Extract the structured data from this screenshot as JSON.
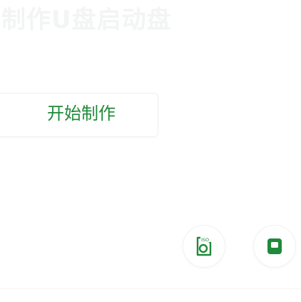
{
  "page": {
    "title": "制作U盘启动盘"
  },
  "actions": {
    "start_label": "开始制作"
  },
  "icons": {
    "iso": "iso-disc-icon",
    "iso_text": "ISO",
    "usb": "usb-drive-icon"
  },
  "colors": {
    "accent": "#1f8a3a",
    "title_faint": "#f3f4f4",
    "border": "#eef0ef"
  }
}
